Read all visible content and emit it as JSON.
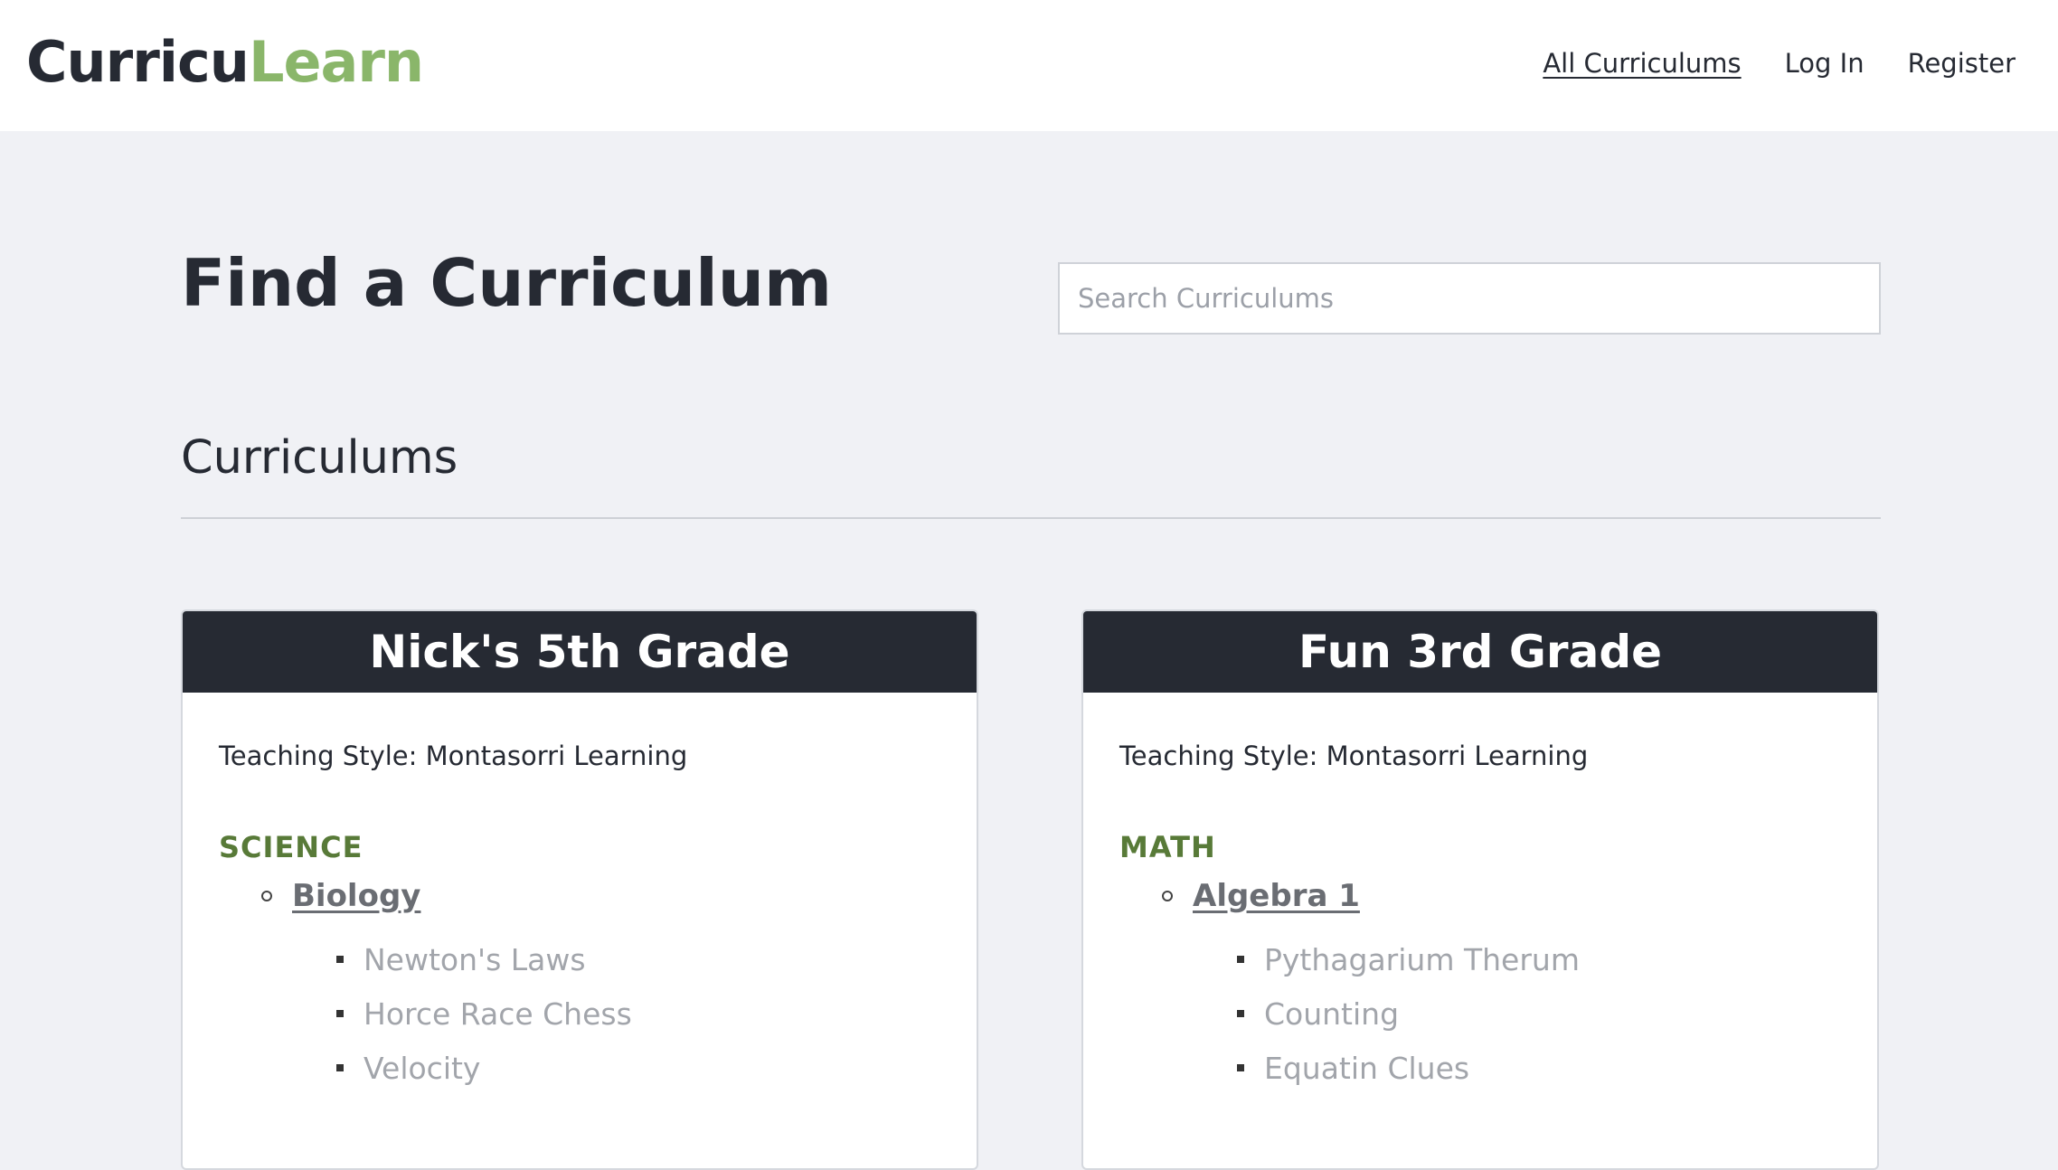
{
  "header": {
    "logo": {
      "part1": "Curricu",
      "part2": "Learn"
    },
    "nav": [
      {
        "label": "All Curriculums"
      },
      {
        "label": "Log In"
      },
      {
        "label": "Register"
      }
    ]
  },
  "main": {
    "title": "Find a Curriculum",
    "search": {
      "placeholder": "Search Curriculums",
      "value": ""
    },
    "section_heading": "Curriculums",
    "cards": [
      {
        "title": "Nick's 5th Grade",
        "teaching_style": "Teaching Style: Montasorri Learning",
        "subject": "SCIENCE",
        "course": "Biology",
        "lessons": [
          "Newton's Laws",
          "Horce Race Chess",
          "Velocity"
        ]
      },
      {
        "title": "Fun 3rd Grade",
        "teaching_style": "Teaching Style: Montasorri Learning",
        "subject": "MATH",
        "course": "Algebra 1",
        "lessons": [
          "Pythagarium Therum",
          "Counting",
          "Equatin Clues"
        ]
      }
    ]
  },
  "colors": {
    "dark": "#262a33",
    "brand_green": "#8ab66a",
    "subject_green": "#587a38",
    "background": "#f0f1f5"
  }
}
